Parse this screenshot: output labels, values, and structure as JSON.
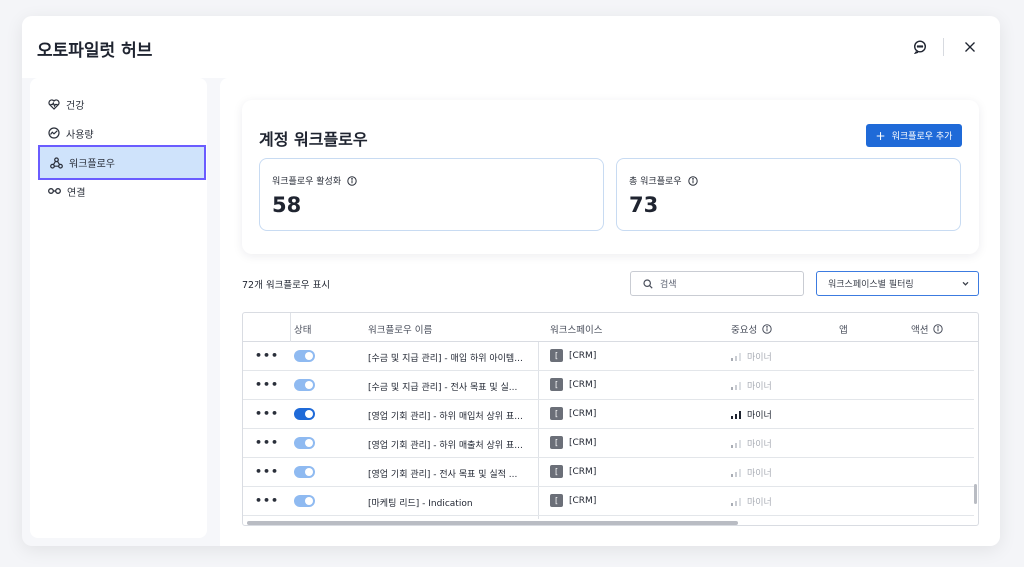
{
  "window": {
    "title": "오토파일럿 허브",
    "icons": [
      "chat-icon",
      "close-icon"
    ]
  },
  "sidebar": {
    "items": [
      {
        "label": "건강",
        "icon": "heart-pulse-icon"
      },
      {
        "label": "사용량",
        "icon": "gauge-icon"
      },
      {
        "label": "워크플로우",
        "icon": "workflow-icon",
        "active": true
      },
      {
        "label": "연결",
        "icon": "link-icon"
      }
    ]
  },
  "main": {
    "card": {
      "title": "계정 워크플로우",
      "add_button": "워크플로우 추가",
      "stats": [
        {
          "label": "워크플로우 활성화",
          "value": "58"
        },
        {
          "label": "총 워크플로우",
          "value": "73"
        }
      ]
    },
    "count_text": "72개 워크플로우 표시",
    "search": {
      "placeholder": "검색"
    },
    "filter": {
      "value": "워크스페이스별 필터링"
    },
    "table": {
      "headers": {
        "status": "상태",
        "name": "워크플로우 이름",
        "workspace": "워크스페이스",
        "importance": "중요성",
        "app": "앱",
        "action": "액션"
      },
      "more_glyph": "•••",
      "rows": [
        {
          "enabled": true,
          "emphasized": false,
          "name": "[수금 및 지급 관리] - 매입 하위 아이템...",
          "workspace_badge": "[",
          "workspace": "[CRM]",
          "importance": "마이너"
        },
        {
          "enabled": true,
          "emphasized": false,
          "name": "[수금 및 지급 관리] - 전사 목표 및 실...",
          "workspace_badge": "[",
          "workspace": "[CRM]",
          "importance": "마이너"
        },
        {
          "enabled": true,
          "emphasized": true,
          "name": "[영업 기회 관리] - 하위 매입처 상위 표...",
          "workspace_badge": "[",
          "workspace": "[CRM]",
          "importance": "마이너"
        },
        {
          "enabled": true,
          "emphasized": false,
          "name": "[영업 기회 관리] - 하위 매출처 상위 표...",
          "workspace_badge": "[",
          "workspace": "[CRM]",
          "importance": "마이너"
        },
        {
          "enabled": true,
          "emphasized": false,
          "name": "[영업 기회 관리] - 전사 목표 및 실적 ...",
          "workspace_badge": "[",
          "workspace": "[CRM]",
          "importance": "마이너"
        },
        {
          "enabled": true,
          "emphasized": false,
          "name": "[마케팅 리드] - Indication",
          "workspace_badge": "[",
          "workspace": "[CRM]",
          "importance": "마이너"
        }
      ]
    }
  },
  "colors": {
    "accent": "#1f6ad8",
    "toggle_light": "#8fbaf1",
    "active_nav_bg": "#cfe3fb",
    "active_nav_outline": "#6a5cff",
    "muted_text": "#a9adb5"
  }
}
